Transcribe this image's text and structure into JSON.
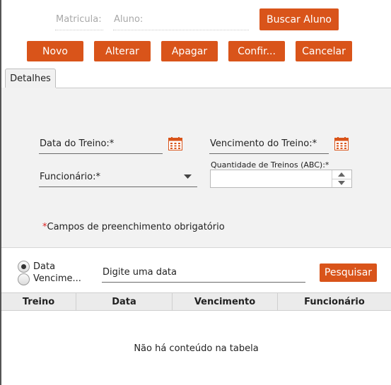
{
  "header": {
    "matricula_label": "Matricula:",
    "aluno_label": "Aluno:",
    "buscar_button": "Buscar Aluno"
  },
  "toolbar": {
    "novo": "Novo",
    "alterar": "Alterar",
    "apagar": "Apagar",
    "confirmar": "Confir...",
    "cancelar": "Cancelar"
  },
  "tabs": [
    {
      "label": "Detalhes",
      "selected": true
    }
  ],
  "form": {
    "data_treino_label": "Data do Treino:*",
    "vencimento_label": "Vencimento do Treino:*",
    "funcionario_label": "Funcionário:*",
    "quantidade_label": "Quantidade de Treinos (ABC):*",
    "quantidade_value": "",
    "required_star": "*",
    "required_note": "Campos  de preenchimento obrigatório"
  },
  "search": {
    "radio_data": "Data",
    "radio_vencimento": "Vencime...",
    "selected": "Data",
    "placeholder": "Digite uma data",
    "button": "Pesquisar"
  },
  "table": {
    "columns": [
      "Treino",
      "Data",
      "Vencimento",
      "Funcionário"
    ],
    "rows": [],
    "empty_message": "Não há conteúdo na tabela"
  },
  "colors": {
    "accent": "#d9541a",
    "panel": "#f2f2f2",
    "header_bg": "#ebebeb"
  },
  "icons": [
    "calendar-icon",
    "chevron-down-icon",
    "spinner-up-icon",
    "spinner-down-icon"
  ]
}
